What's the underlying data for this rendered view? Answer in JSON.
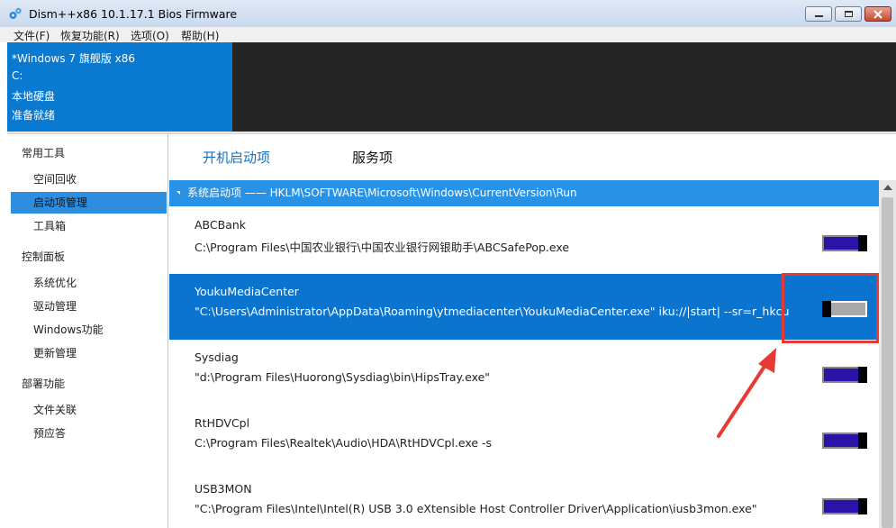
{
  "window": {
    "title": "Dism++x86 10.1.17.1 Bios Firmware",
    "app_icon": "gears-icon"
  },
  "menu": [
    "文件(F)",
    "恢复功能(R)",
    "选项(O)",
    "帮助(H)"
  ],
  "info": {
    "lines": [
      "*Windows 7 旗舰版 x86",
      "C:",
      "本地硬盘",
      "准备就绪"
    ],
    "accent_color": "#0a79d0"
  },
  "sidebar": {
    "groups": [
      {
        "label": "常用工具",
        "items": [
          "空间回收",
          "启动项管理",
          "工具箱"
        ]
      },
      {
        "label": "控制面板",
        "items": [
          "系统优化",
          "驱动管理",
          "Windows功能",
          "更新管理"
        ]
      },
      {
        "label": "部署功能",
        "items": [
          "文件关联",
          "预应答"
        ]
      }
    ],
    "selected_item": "启动项管理"
  },
  "tabs": [
    {
      "label": "开机启动项",
      "active": true
    },
    {
      "label": "服务项",
      "active": false
    }
  ],
  "group_header": "系统启动项 —— HKLM\\SOFTWARE\\Microsoft\\Windows\\CurrentVersion\\Run",
  "entries": [
    {
      "name": "ABCBank",
      "path": "C:\\Program Files\\中国农业银行\\中国农业银行网银助手\\ABCSafePop.exe",
      "enabled": true,
      "selected": false
    },
    {
      "name": "YoukuMediaCenter",
      "path": "\"C:\\Users\\Administrator\\AppData\\Roaming\\ytmediacenter\\YoukuMediaCenter.exe\" iku://|start| --sr=r_hkcu",
      "enabled": false,
      "selected": true
    },
    {
      "name": "Sysdiag",
      "path": "\"d:\\Program Files\\Huorong\\Sysdiag\\bin\\HipsTray.exe\"",
      "enabled": true,
      "selected": false
    },
    {
      "name": "RtHDVCpl",
      "path": "C:\\Program Files\\Realtek\\Audio\\HDA\\RtHDVCpl.exe -s",
      "enabled": true,
      "selected": false
    },
    {
      "name": "USB3MON",
      "path": "\"C:\\Program Files\\Intel\\Intel(R) USB 3.0 eXtensible Host Controller Driver\\Application\\iusb3mon.exe\"",
      "enabled": true,
      "selected": false
    }
  ],
  "colors": {
    "toggle_on": "#2c12a8",
    "selection": "#0b74cf",
    "annotation": "#e83a35"
  }
}
